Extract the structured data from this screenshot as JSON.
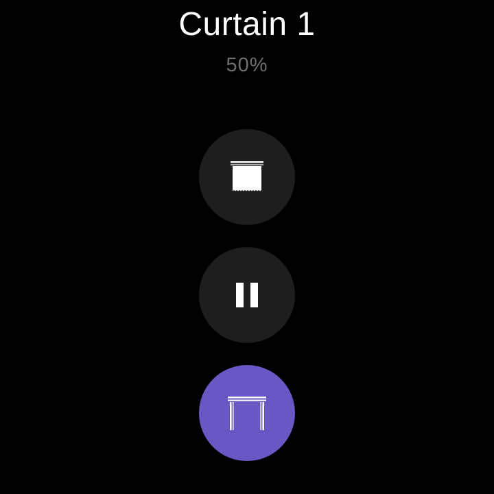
{
  "device": {
    "name": "Curtain 1",
    "position_text": "50%"
  },
  "controls": [
    {
      "id": "close",
      "icon": "curtain-closed-icon",
      "active": false
    },
    {
      "id": "pause",
      "icon": "pause-icon",
      "active": false
    },
    {
      "id": "open",
      "icon": "curtain-open-icon",
      "active": true
    }
  ],
  "colors": {
    "background": "#000000",
    "button": "#1e1e1e",
    "button_active": "#6a57c4",
    "title": "#ffffff",
    "subtitle": "#6f6f6f",
    "icon": "#ffffff"
  }
}
